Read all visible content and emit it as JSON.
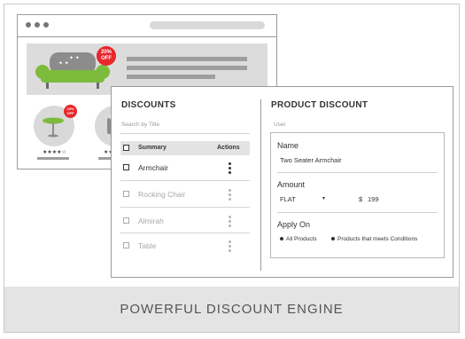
{
  "discounts": {
    "title": "DISCOUNTS",
    "search_placeholder": "Search by Title",
    "headers": {
      "summary": "Summary",
      "actions": "Actions"
    },
    "rows": [
      {
        "label": "Armchair",
        "active": true
      },
      {
        "label": "Rocking Chair",
        "active": false
      },
      {
        "label": "Almirah",
        "active": false
      },
      {
        "label": "Table",
        "active": false
      }
    ]
  },
  "product_discount": {
    "title": "PRODUCT DISCOUNT",
    "subtitle": "User",
    "name_label": "Name",
    "name_value": "Two Seater Armchair",
    "amount_label": "Amount",
    "amount_type": "FLAT",
    "dropdown_arrow": "▾",
    "currency": "$",
    "amount_value": "199",
    "apply_label": "Apply On",
    "apply_options": [
      "All Products",
      "Products that meets Conditions"
    ]
  },
  "illustration": {
    "banner_badge_line1": "20%",
    "banner_badge_line2": "OFF",
    "product_badge_line1": "20%",
    "product_badge_line2": "OFF",
    "rating_stars": "★★★★☆",
    "colors": {
      "sofa": "#7dbb3c",
      "sofa_back": "#8c8c8c",
      "badge": "#e8262b",
      "table_top": "#7dbb3c"
    }
  },
  "footer": {
    "caption": "POWERFUL DISCOUNT ENGINE"
  }
}
